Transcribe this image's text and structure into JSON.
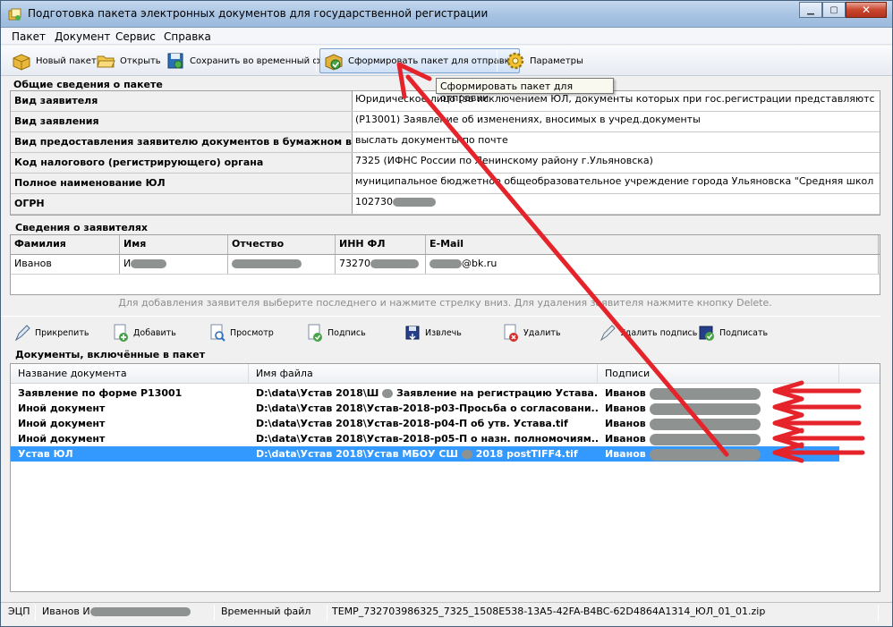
{
  "window": {
    "title": "Подготовка пакета электронных документов для государственной регистрации",
    "controls": {
      "minimize": "▁",
      "maximize": "▢",
      "close": "✕"
    }
  },
  "menu": [
    "Пакет",
    "Документ",
    "Сервис",
    "Справка"
  ],
  "toolbar": {
    "new_label": "Новый пакет",
    "open_label": "Открыть",
    "save_label": "Сохранить во временный файл",
    "form_label": "Сформировать пакет для отправки",
    "params_label": "Параметры"
  },
  "tooltip": "Сформировать пакет для отправки",
  "general": {
    "section_title": "Общие сведения о пакете",
    "rows": [
      {
        "key": "Вид заявителя",
        "value": "Юридическое лицо (за исключением ЮЛ, документы которых при гос.регистрации представляютс"
      },
      {
        "key": "Вид заявления",
        "value": "(Р13001) Заявление об изменениях, вносимых в учред.документы"
      },
      {
        "key": "Вид предоставления заявителю документов в бумажном виде",
        "value": "выслать документы по почте"
      },
      {
        "key": "Код налогового (регистрирующего) органа",
        "value": "7325 (ИФНС России по Ленинскому району г.Ульяновска)"
      },
      {
        "key": "Полное наименование ЮЛ",
        "value": "муниципальное бюджетное общеобразовательное учреждение города Ульяновска \"Средняя школ"
      },
      {
        "key": "ОГРН",
        "value": "102730"
      }
    ]
  },
  "applicants": {
    "section_title": "Сведения о заявителях",
    "columns": [
      "Фамилия",
      "Имя",
      "Отчество",
      "ИНН ФЛ",
      "E-Mail"
    ],
    "row": {
      "surname": "Иванов",
      "name": "И",
      "patronymic": "",
      "inn": "73270",
      "email": "@bk.ru"
    },
    "hint": "Для добавления заявителя выберите последнего и нажмите стрелку вниз. Для удаления заявителя нажмите кнопку Delete."
  },
  "doc_toolbar": {
    "attach": "Прикрепить",
    "add": "Добавить",
    "view": "Просмотр",
    "sign": "Подпись",
    "extract": "Извлечь",
    "delete": "Удалить",
    "delete_sign": "Удалить подпись",
    "sign_doc": "Подписать"
  },
  "documents": {
    "section_title": "Документы, включённые в пакет",
    "columns": [
      "Название документа",
      "Имя файла",
      "Подписи"
    ],
    "rows": [
      {
        "name": "Заявление по форме Р13001",
        "file": "D:\\data\\Устав 2018\\Ш",
        "file_tail": "Заявление на регистрацию Устава...",
        "signer": "Иванов"
      },
      {
        "name": "Иной документ",
        "file": "D:\\data\\Устав 2018\\Устав-2018-р03-Просьба о согласовани...",
        "file_tail": "",
        "signer": "Иванов"
      },
      {
        "name": "Иной документ",
        "file": "D:\\data\\Устав 2018\\Устав-2018-р04-П об утв. Устава.tif",
        "file_tail": "",
        "signer": "Иванов"
      },
      {
        "name": "Иной документ",
        "file": "D:\\data\\Устав 2018\\Устав-2018-р05-П о назн. полномочиям...",
        "file_tail": "",
        "signer": "Иванов"
      },
      {
        "name": "Устав ЮЛ",
        "file": "D:\\data\\Устав 2018\\Устав МБОУ СШ",
        "file_tail": "2018 postTIFF4.tif",
        "signer": "Иванов"
      }
    ]
  },
  "status": {
    "ecp": "ЭЦП",
    "user": "Иванов И",
    "temp_label": "Временный файл",
    "temp_file": "TEMP_732703986325_7325_1508E538-13A5-42FA-B4BC-62D4864A1314_ЮЛ_01_01.zip"
  },
  "colors": {
    "annotation": "#e5232a",
    "selection": "#3399ff",
    "redaction": "#8e9391"
  }
}
